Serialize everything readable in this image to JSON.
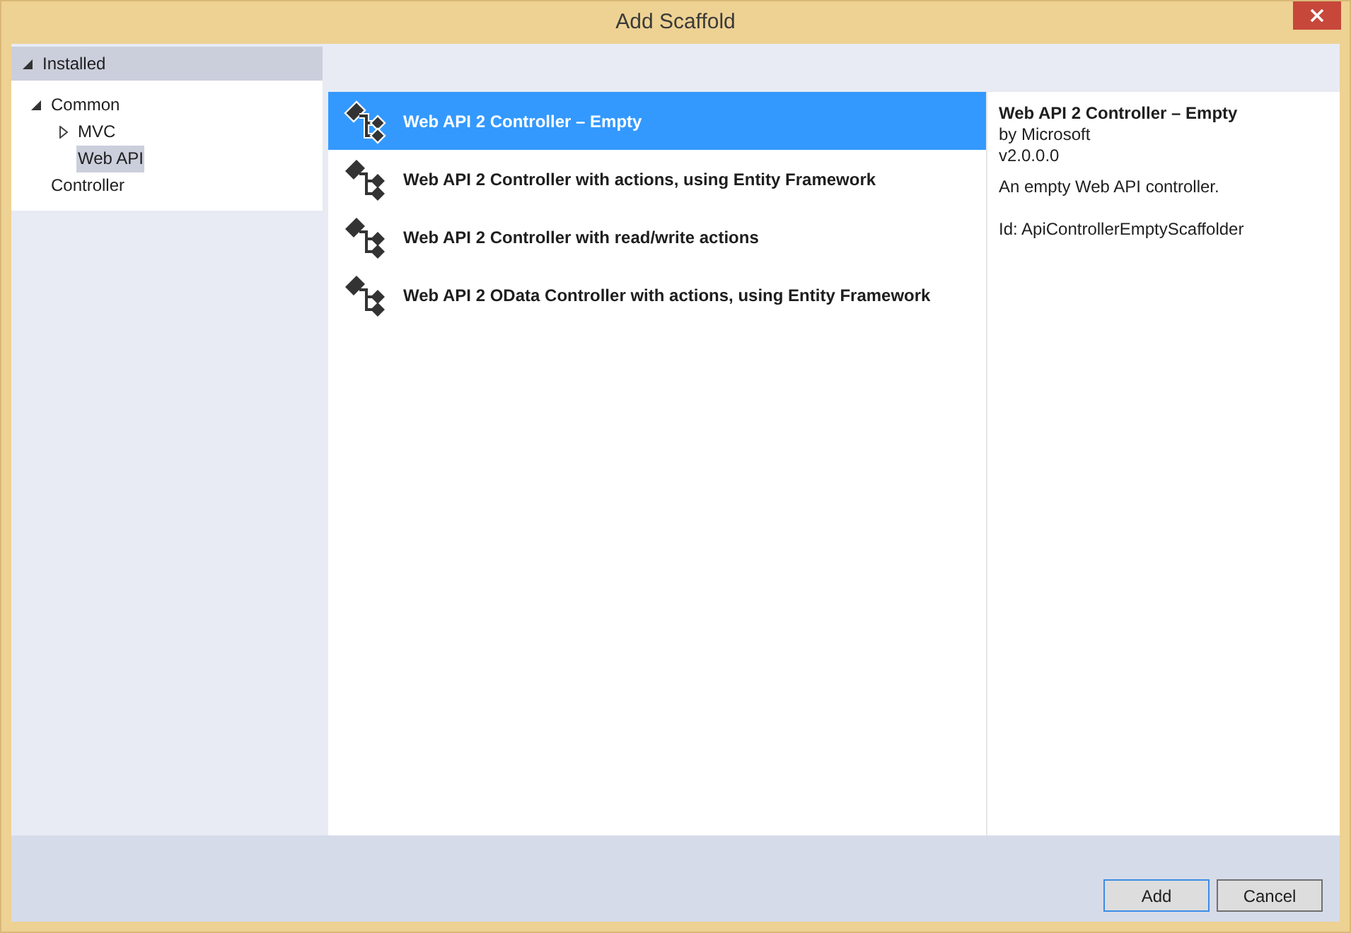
{
  "window": {
    "title": "Add Scaffold"
  },
  "sidebar": {
    "header": {
      "label": "Installed",
      "expanded": true
    },
    "items": [
      {
        "label": "Common",
        "expanded": true,
        "selected": false,
        "children": [
          {
            "label": "MVC",
            "expanded": false,
            "selected": false
          },
          {
            "label": "Web API",
            "selected": true
          }
        ]
      },
      {
        "label": "Controller",
        "selected": false
      }
    ]
  },
  "templates": [
    {
      "label": "Web API 2 Controller – Empty",
      "selected": true
    },
    {
      "label": "Web API 2 Controller with actions, using Entity Framework",
      "selected": false
    },
    {
      "label": "Web API 2 Controller with read/write actions",
      "selected": false
    },
    {
      "label": "Web API 2 OData Controller with actions, using Entity Framework",
      "selected": false
    }
  ],
  "details": {
    "title": "Web API 2 Controller – Empty",
    "author": "by Microsoft",
    "version": "v2.0.0.0",
    "description": "An empty Web API controller.",
    "id": "Id: ApiControllerEmptyScaffolder"
  },
  "buttons": [
    {
      "label": "Add",
      "default": true
    },
    {
      "label": "Cancel",
      "default": false
    }
  ]
}
